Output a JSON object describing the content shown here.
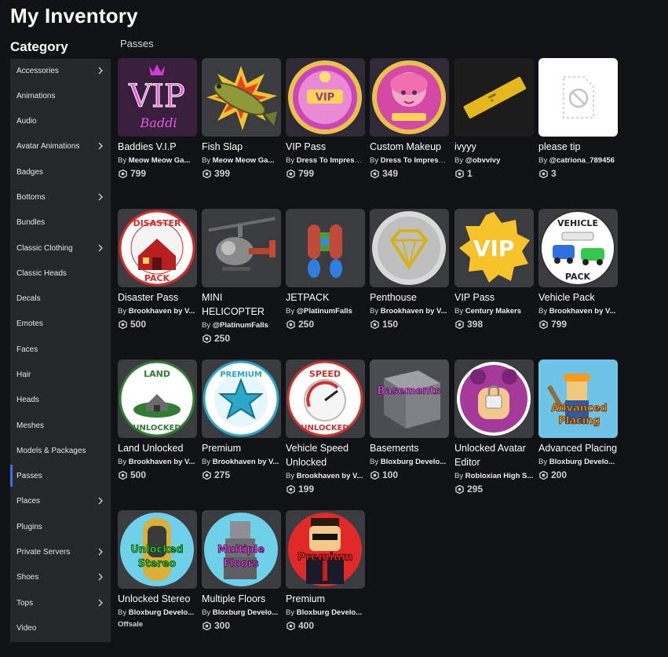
{
  "page": {
    "title": "My Inventory",
    "category_heading": "Category",
    "section": "Passes",
    "creator_prefix": "By "
  },
  "categories": [
    {
      "label": "Accessories",
      "chevron": true
    },
    {
      "label": "Animations",
      "chevron": false
    },
    {
      "label": "Audio",
      "chevron": false
    },
    {
      "label": "Avatar Animations",
      "chevron": true
    },
    {
      "label": "Badges",
      "chevron": false
    },
    {
      "label": "Bottoms",
      "chevron": true
    },
    {
      "label": "Bundles",
      "chevron": false
    },
    {
      "label": "Classic Clothing",
      "chevron": true
    },
    {
      "label": "Classic Heads",
      "chevron": false
    },
    {
      "label": "Decals",
      "chevron": false
    },
    {
      "label": "Emotes",
      "chevron": false
    },
    {
      "label": "Faces",
      "chevron": false
    },
    {
      "label": "Hair",
      "chevron": false
    },
    {
      "label": "Heads",
      "chevron": false
    },
    {
      "label": "Meshes",
      "chevron": false
    },
    {
      "label": "Models & Packages",
      "chevron": false
    },
    {
      "label": "Passes",
      "chevron": false,
      "active": true
    },
    {
      "label": "Places",
      "chevron": true
    },
    {
      "label": "Plugins",
      "chevron": false
    },
    {
      "label": "Private Servers",
      "chevron": true
    },
    {
      "label": "Shoes",
      "chevron": true
    },
    {
      "label": "Tops",
      "chevron": true
    },
    {
      "label": "Video",
      "chevron": false
    }
  ],
  "items": [
    {
      "name": "Baddies V.I.P",
      "creator": "Meow Meow Ga...",
      "price": "799",
      "icon": "vip-crown-icon"
    },
    {
      "name": "Fish Slap",
      "creator": "Meow Meow Ga...",
      "price": "399",
      "icon": "fish-icon"
    },
    {
      "name": "VIP Pass",
      "creator": "Dress To Impress ...",
      "price": "799",
      "icon": "vip-badge-icon"
    },
    {
      "name": "Custom Makeup",
      "creator": "Dress To Impress ...",
      "price": "349",
      "icon": "makeup-icon"
    },
    {
      "name": "ivyyy",
      "creator": "@obvvivy",
      "price": "1",
      "icon": "gold-bar-icon"
    },
    {
      "name": "please tip",
      "creator": "@catriona_789456",
      "price": "3",
      "icon": "blocked-image-icon"
    },
    {
      "name": "Disaster Pass",
      "creator": "Brookhaven by V...",
      "price": "500",
      "icon": "disaster-icon",
      "badge_top": "DISASTER",
      "badge_bottom": "PACK"
    },
    {
      "name": "MINI HELICOPTER",
      "creator": "@PlatinumFalls",
      "price": "250",
      "icon": "helicopter-icon"
    },
    {
      "name": "JETPACK",
      "creator": "@PlatinumFalls",
      "price": "250",
      "icon": "jetpack-icon"
    },
    {
      "name": "Penthouse",
      "creator": "Brookhaven by V...",
      "price": "150",
      "icon": "diamond-icon"
    },
    {
      "name": "VIP Pass",
      "creator": "Century Makers",
      "price": "398",
      "icon": "vip-star-icon",
      "badge_text": "VIP"
    },
    {
      "name": "Vehicle Pack",
      "creator": "Brookhaven by V...",
      "price": "799",
      "icon": "vehicle-icon",
      "badge_top": "VEHICLE",
      "badge_bottom": "PACK"
    },
    {
      "name": "Land Unlocked",
      "creator": "Brookhaven by V...",
      "price": "500",
      "icon": "land-icon",
      "badge_top": "LAND",
      "badge_bottom": "UNLOCKED"
    },
    {
      "name": "Premium",
      "creator": "Brookhaven by V...",
      "price": "275",
      "icon": "premium-star-icon",
      "badge_top": "PREMIUM"
    },
    {
      "name": "Vehicle Speed Unlocked",
      "creator": "Brookhaven by V...",
      "price": "199",
      "icon": "speedometer-icon",
      "badge_top": "SPEED",
      "badge_bottom": "UNLOCKED"
    },
    {
      "name": "Basements",
      "creator": "Bloxburg Develo...",
      "price": "100",
      "icon": "basement-icon",
      "badge_text": "Basements"
    },
    {
      "name": "Unlocked Avatar Editor",
      "creator": "Robloxian High S...",
      "price": "295",
      "icon": "avatar-lock-icon"
    },
    {
      "name": "Advanced Placing",
      "creator": "Bloxburg Develo...",
      "price": "200",
      "icon": "builder-icon",
      "badge_line1": "Advanced",
      "badge_line2": "Placing"
    },
    {
      "name": "Unlocked Stereo",
      "creator": "Bloxburg Develo...",
      "price": "",
      "offsale": "Offsale",
      "icon": "stereo-icon",
      "badge_line1": "Unlocked",
      "badge_line2": "Stereo"
    },
    {
      "name": "Multiple Floors",
      "creator": "Bloxburg Develo...",
      "price": "300",
      "icon": "floors-icon",
      "badge_line1": "Multiple",
      "badge_line2": "Floors"
    },
    {
      "name": "Premium",
      "creator": "Bloxburg Develo...",
      "price": "400",
      "icon": "premium-avatar-icon",
      "badge_text": "Premium"
    }
  ],
  "colors": {
    "background": "#111214",
    "sidebar": "#25272b",
    "card": "#393b3f",
    "active_accent": "#3c6ef0"
  }
}
